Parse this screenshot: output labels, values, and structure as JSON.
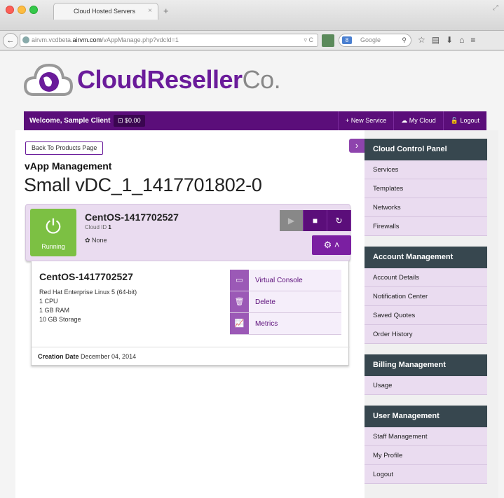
{
  "browser": {
    "tab_title": "Cloud Hosted Servers",
    "tab_close": "×",
    "new_tab": "+",
    "url_host_prefix": "airvm.vcdbeta.",
    "url_host_domain": "airvm.com",
    "url_path": "/vAppManage.php?vdcId=1",
    "search_placeholder": "Google",
    "search_engine_badge": "8"
  },
  "header": {
    "logo_main": "CloudReseller",
    "logo_suffix": "Co.",
    "welcome": "Welcome, Sample Client",
    "balance": "$0.00",
    "links": [
      {
        "icon": "+",
        "label": "New Service"
      },
      {
        "icon": "☁",
        "label": "My Cloud"
      },
      {
        "icon": "🔓",
        "label": "Logout"
      }
    ]
  },
  "main": {
    "back_button": "Back To Products Page",
    "section_title": "vApp Management",
    "vdc_name": "Small vDC_1_1417701802-0",
    "vm": {
      "name": "CentOS-1417702527",
      "cloud_id_label": "Cloud ID",
      "cloud_id": "1",
      "status": "Running",
      "tag": "None",
      "os": "Red Hat Enterprise Linux 5 (64-bit)",
      "cpu": "1 CPU",
      "ram": "1 GB RAM",
      "storage": "10 GB Storage",
      "creation_label": "Creation Date",
      "creation_date": "December 04, 2014"
    },
    "actions": [
      {
        "icon": "monitor-icon",
        "label": "Virtual Console"
      },
      {
        "icon": "trash-icon",
        "label": "Delete"
      },
      {
        "icon": "chart-icon",
        "label": "Metrics"
      }
    ]
  },
  "sidebar": {
    "groups": [
      {
        "title": "Cloud Control Panel",
        "items": [
          "Services",
          "Templates",
          "Networks",
          "Firewalls"
        ]
      },
      {
        "title": "Account Management",
        "items": [
          "Account Details",
          "Notification Center",
          "Saved Quotes",
          "Order History"
        ]
      },
      {
        "title": "Billing Management",
        "items": [
          "Usage"
        ]
      },
      {
        "title": "User Management",
        "items": [
          "Staff Management",
          "My Profile",
          "Logout"
        ]
      }
    ]
  },
  "colors": {
    "brand_purple": "#5b0e7a",
    "accent_purple": "#7b1fa2",
    "running_green": "#7cc043",
    "sidebar_head": "#37474f"
  }
}
